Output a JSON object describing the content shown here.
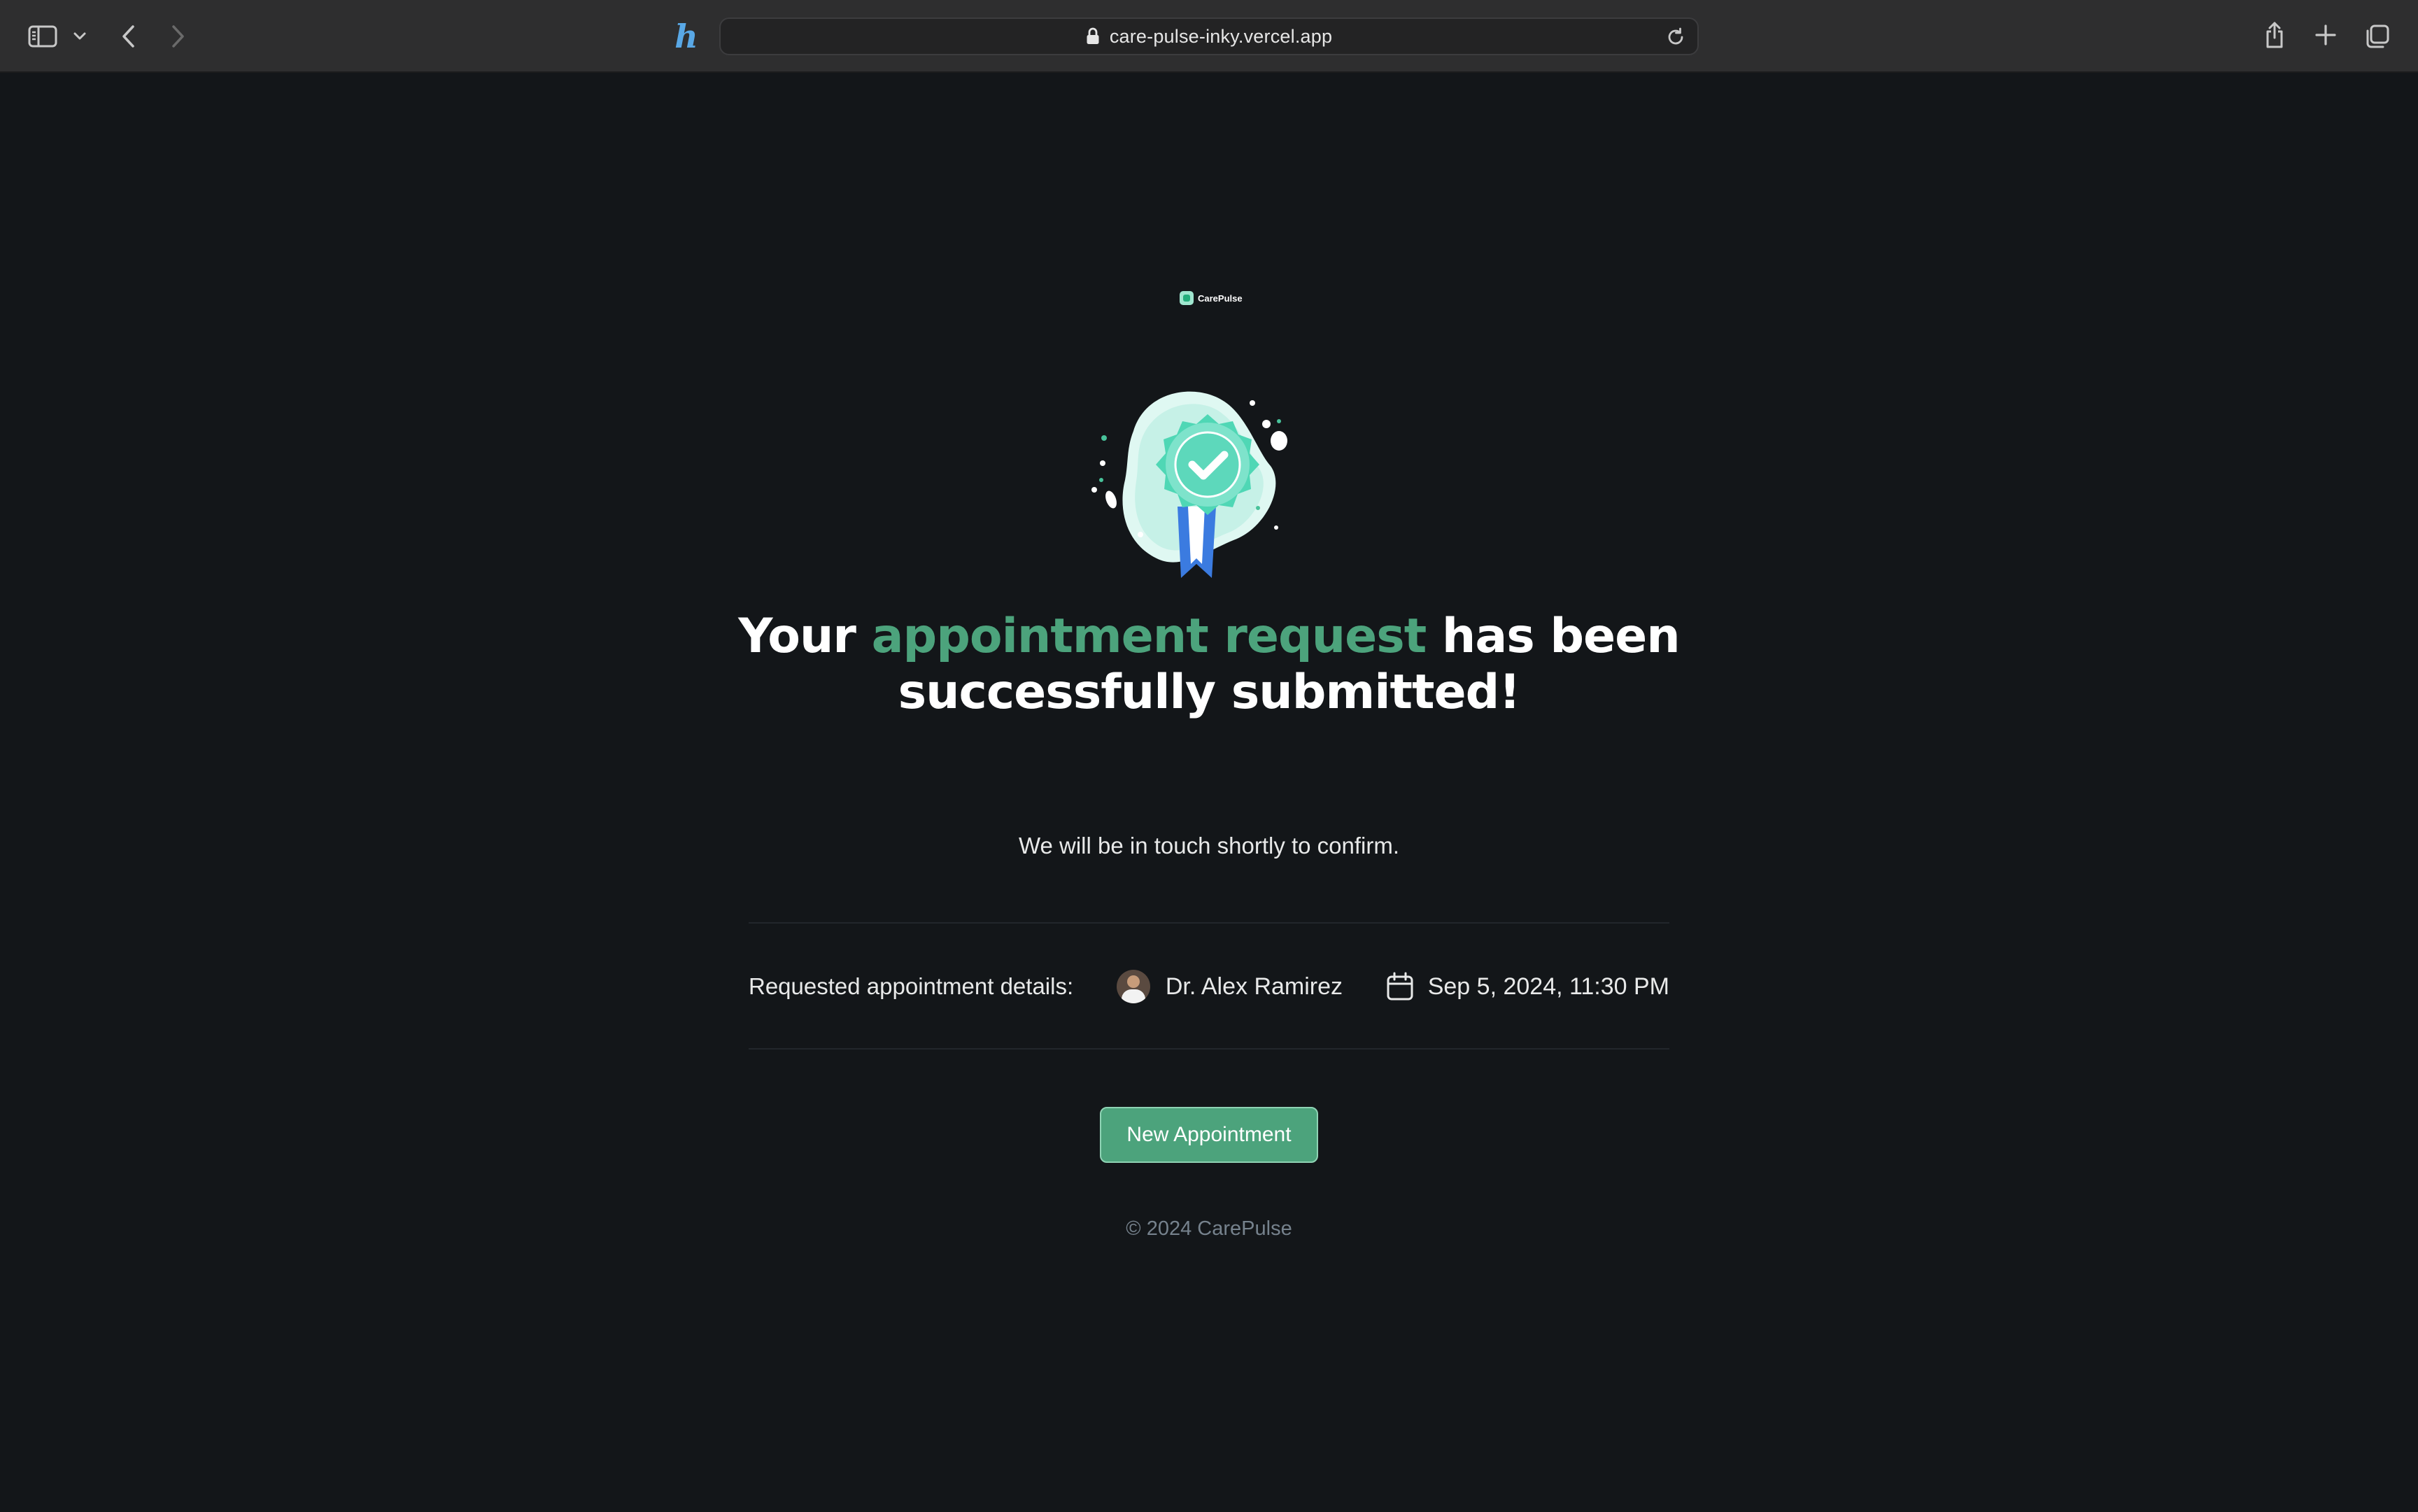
{
  "browser": {
    "url": "care-pulse-inky.vercel.app",
    "extension_letter": "h",
    "icons": {
      "sidebar": "sidebar-icon",
      "sidebar_menu": "chevron-down-icon",
      "back": "chevron-left-icon",
      "forward": "chevron-right-icon",
      "lock": "lock-icon",
      "reload": "reload-icon",
      "share": "share-icon",
      "new_tab": "plus-icon",
      "tabs": "tab-overview-icon"
    }
  },
  "brand": {
    "name": "CarePulse"
  },
  "success": {
    "headline_prefix": "Your ",
    "headline_accent": "appointment request",
    "headline_suffix": " has been successfully submitted!",
    "subtitle": "We will be in touch shortly to confirm."
  },
  "details": {
    "label": "Requested appointment details:",
    "doctor": "Dr. Alex Ramirez",
    "date": "Sep 5, 2024, 11:30 PM"
  },
  "actions": {
    "new_appointment": "New Appointment"
  },
  "footer": {
    "copyright": "© 2024 CarePulse"
  },
  "colors": {
    "background": "#131619",
    "accent": "#4ca37c",
    "toolbar": "#2e2e2f"
  }
}
